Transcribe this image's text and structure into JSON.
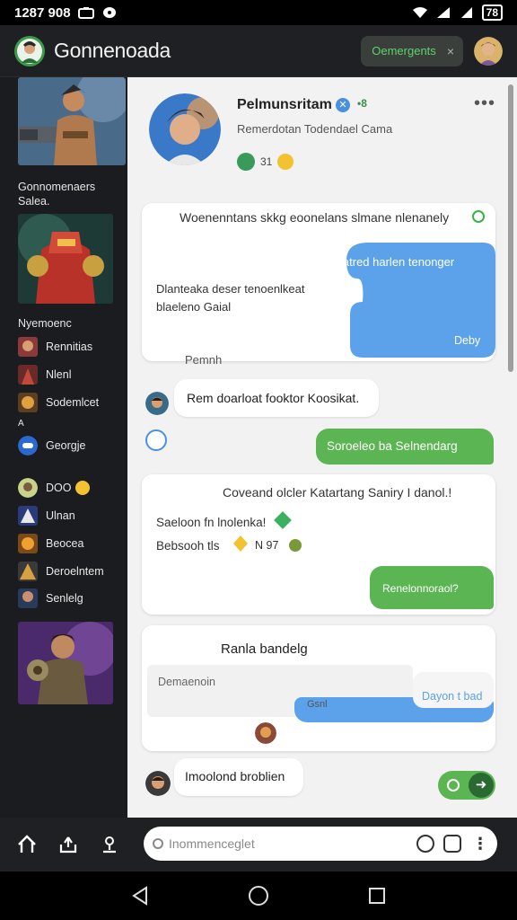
{
  "status_bar": {
    "time": "1287 908",
    "battery": "78"
  },
  "app": {
    "title": "Gonnenoada",
    "chip_label": "Oemergents",
    "chip_close": "×"
  },
  "sidebar": {
    "section1": "Gonnomenaers Salea.",
    "section2": "Nyemoenc",
    "items": [
      {
        "label": "Rennitias",
        "icon": "game-character-icon"
      },
      {
        "label": "Nlenl",
        "icon": "game-character-icon"
      },
      {
        "label": "Sodemlcet",
        "icon": "game-character-icon"
      },
      {
        "label": "Georgje",
        "icon": "controller-icon"
      },
      {
        "label": "DOO",
        "icon": "avatar-icon"
      },
      {
        "label": "Ulnan",
        "icon": "game-character-icon"
      },
      {
        "label": "Beocea",
        "icon": "game-character-icon"
      },
      {
        "label": "Deroelntem",
        "icon": "game-character-icon"
      },
      {
        "label": "Senlelg",
        "icon": "game-character-icon"
      }
    ],
    "stray_mark": "A"
  },
  "profile": {
    "name": "Pelmunsritam",
    "count": "•8",
    "subtitle": "Remerdotan Todendael Cama",
    "stat": "31",
    "more": "•••"
  },
  "messages": {
    "m1": "Woenenntans skkg eoonelans slmane nlenanely",
    "m2": "Beatred harlen tenonger",
    "m3": "Dlanteaka deser tenoenlkeat blaeleno Gaial",
    "m4": "Deby",
    "m5": "Pemnh",
    "m6": "Rem doarloat fooktor Koosikat.",
    "m7": "Soroeleo ba Selnendarg",
    "m8": "Coveand olcler Katartang Saniry I danol.!",
    "m9": "Saeloon fn lnolenka!",
    "m10": "Bebsooh tls",
    "m10b": "N 97",
    "m11": "Renelonnoraol?",
    "m12": "Ranla bandelg",
    "m13": "Demaenoin",
    "m14": "Gsnl",
    "m15": "Dayon t bad",
    "m16": "Imoolond broblien"
  },
  "composer": {
    "placeholder": "Inommenceglet"
  },
  "colors": {
    "accent_green": "#5bb552",
    "accent_blue": "#5ba2ea",
    "chip_text": "#5ed36a"
  }
}
